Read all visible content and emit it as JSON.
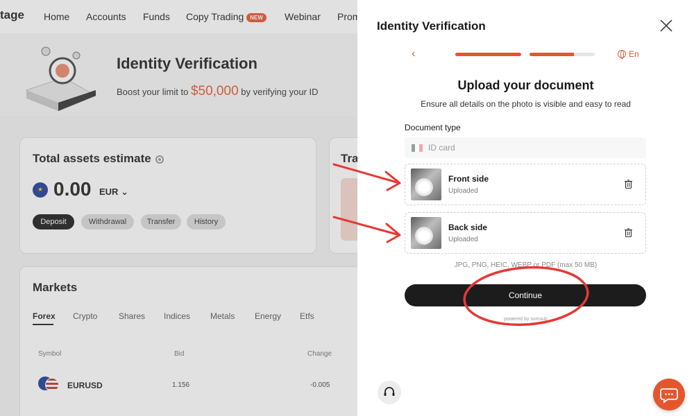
{
  "nav": {
    "brand": "tage",
    "items": [
      "Home",
      "Accounts",
      "Funds",
      "Copy Trading",
      "Webinar",
      "Prom"
    ],
    "copy_trading_badge": "NEW"
  },
  "hero": {
    "title": "Identity Verification",
    "subtitle_prefix": "Boost your limit to",
    "amount": "$50,000",
    "subtitle_suffix": "by verifying your ID"
  },
  "assets": {
    "title": "Total assets estimate",
    "balance": "0.00",
    "currency": "EUR",
    "buttons": [
      "Deposit",
      "Withdrawal",
      "Transfer",
      "History"
    ]
  },
  "partial_card_title": "Tra",
  "markets": {
    "title": "Markets",
    "tabs": [
      "Forex",
      "Crypto",
      "Shares",
      "Indices",
      "Metals",
      "Energy",
      "Etfs"
    ],
    "columns": [
      "Symbol",
      "Bid",
      "Change"
    ],
    "rows": [
      {
        "symbol": "EURUSD",
        "bid": "1.156",
        "change": "-0.005"
      }
    ]
  },
  "panel": {
    "title": "Identity Verification",
    "progress": [
      1.0,
      0.68
    ],
    "language": "En",
    "upload_title": "Upload your document",
    "upload_subtitle": "Ensure all details on the photo is visible and easy to read",
    "document_type_label": "Document type",
    "document_type_value": "ID card",
    "documents": [
      {
        "name": "Front side",
        "status": "Uploaded"
      },
      {
        "name": "Back side",
        "status": "Uploaded"
      }
    ],
    "formats": "JPG, PNG, HEIC, WEBP or PDF (max 50 MB)",
    "continue_label": "Continue",
    "powered_by": "powered by sumsub"
  },
  "colors": {
    "accent": "#e4572e",
    "button_dark": "#1c1c1c",
    "annotation": "#e53935"
  }
}
